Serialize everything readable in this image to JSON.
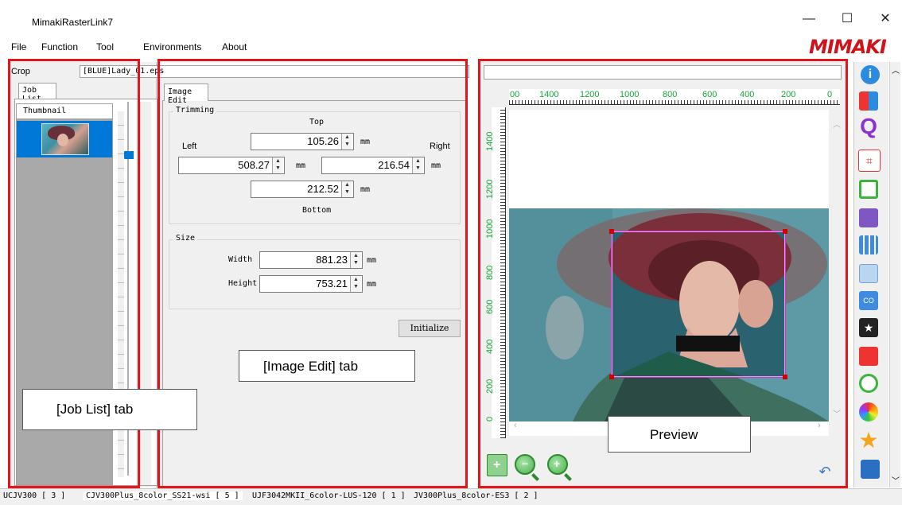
{
  "window": {
    "title": "MimakiRasterLink7",
    "brand": "MIMAKI",
    "controls": [
      "—",
      "☐",
      "✕"
    ]
  },
  "menu": [
    "File",
    "Function",
    "Tool",
    "Environments",
    "About"
  ],
  "left_panel": {
    "mode_label": "Crop",
    "job_name": "[BLUE]Lady_01.eps",
    "tab": "Job List",
    "column_header": "Thumbnail"
  },
  "image_edit": {
    "tab": "Image Edit",
    "trimming": {
      "title": "Trimming",
      "top_label": "Top",
      "left_label": "Left",
      "right_label": "Right",
      "bottom_label": "Bottom",
      "top_value": "105.26",
      "left_value": "508.27",
      "right_value": "216.54",
      "bottom_value": "212.52",
      "unit": "mm"
    },
    "size": {
      "title": "Size",
      "width_label": "Width",
      "height_label": "Height",
      "width_value": "881.23",
      "height_value": "753.21",
      "unit": "mm"
    },
    "initialize_label": "Initialize"
  },
  "preview": {
    "ruler_top": [
      "00",
      "1400",
      "1200",
      "1000",
      "800",
      "600",
      "400",
      "200",
      "0"
    ],
    "ruler_left": [
      "1400",
      "1200",
      "1000",
      "800",
      "600",
      "400",
      "200",
      "0"
    ]
  },
  "callouts": {
    "job_list": "[Job List] tab",
    "image_edit": "[Image Edit] tab",
    "preview": "Preview"
  },
  "status_tabs": [
    "UCJV300 [ 3 ]",
    "CJV300Plus_8color_SS21-wsi [ 5 ]",
    "UJF3042MKII_6color-LUS-120 [ 1 ]",
    "JV300Plus_8color-ES3 [ 2 ]"
  ],
  "toolbar_icons": [
    "info-icon",
    "layout-icon",
    "search-q-icon",
    "crop-icon",
    "frame-icon",
    "copy-layout-icon",
    "tiling-icon",
    "duplicate-icon",
    "color-collection-icon",
    "special-color-icon",
    "red-icon",
    "layer-icon",
    "color-adjust-icon",
    "star-icon",
    "document-icon"
  ],
  "colors": {
    "accent_red": "#e8141c",
    "brand_red": "#d0121b",
    "ruler_green": "#17a53b",
    "selection_blue": "#0078d7"
  }
}
